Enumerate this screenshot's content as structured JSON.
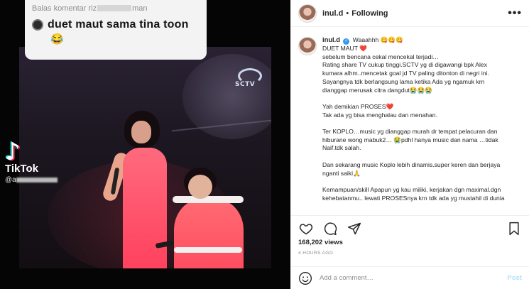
{
  "video": {
    "overlay_comment": {
      "reply_prefix": "Balas komentar riz",
      "reply_suffix": "man",
      "text": "duet maut sama tina toon",
      "emoji": "😂"
    },
    "watermark": {
      "app_name": "TikTok",
      "handle_prefix": "@a"
    },
    "channel_logo": "SCTV"
  },
  "post": {
    "author": "inul.d",
    "follow_status": "Following",
    "separator": "•",
    "more_label": "•••",
    "caption_username": "inul.d",
    "caption_lines": [
      "Waaahhh 😋😋😋",
      "DUET MAUT ❤️",
      "sebelum bencana cekal mencekal terjadi…",
      "Rating share TV cukup tinggi.SCTV yg di digawangi bpk Alex",
      "kumara alhm..mencetak goal jd TV paling ditonton di negri ini.",
      "Sayangnya tdk berlangsung lama ketika Ada yg ngamuk krn",
      "dianggap merusak citra dangdut😭😭😭",
      "",
      "Yah demikian PROSES❤️",
      "Tak ada yg bisa menghalau dan menahan.",
      "",
      "Ter KOPLO…music yg dianggap murah dr tempat pelacuran dan",
      "hiburane wong mabuk2… 😭pdhl hanya music dan nama …tidak",
      "Naif.tdk salah.",
      "",
      "Dan sekarang music Koplo lebih dinamis.super keren dan berjaya",
      "nganti saiki🙏",
      "",
      "Kemampuan/skill Apapun yg kau miliki, kerjakan dgn maximal.dgn",
      "kehebatanmu.. lewati PROSESnya krn tdk ada yg mustahil di dunia"
    ],
    "views": "168,202 views",
    "timestamp": "4 HOURS AGO",
    "comment_placeholder": "Add a comment…",
    "post_button": "Post"
  },
  "icons": {
    "like": "heart-icon",
    "comment": "comment-icon",
    "share": "share-icon",
    "save": "bookmark-icon",
    "emoji": "smile-icon"
  },
  "colors": {
    "verified": "#3897f0",
    "post_button": "#b2dffc",
    "muted": "#8e8e8e"
  }
}
